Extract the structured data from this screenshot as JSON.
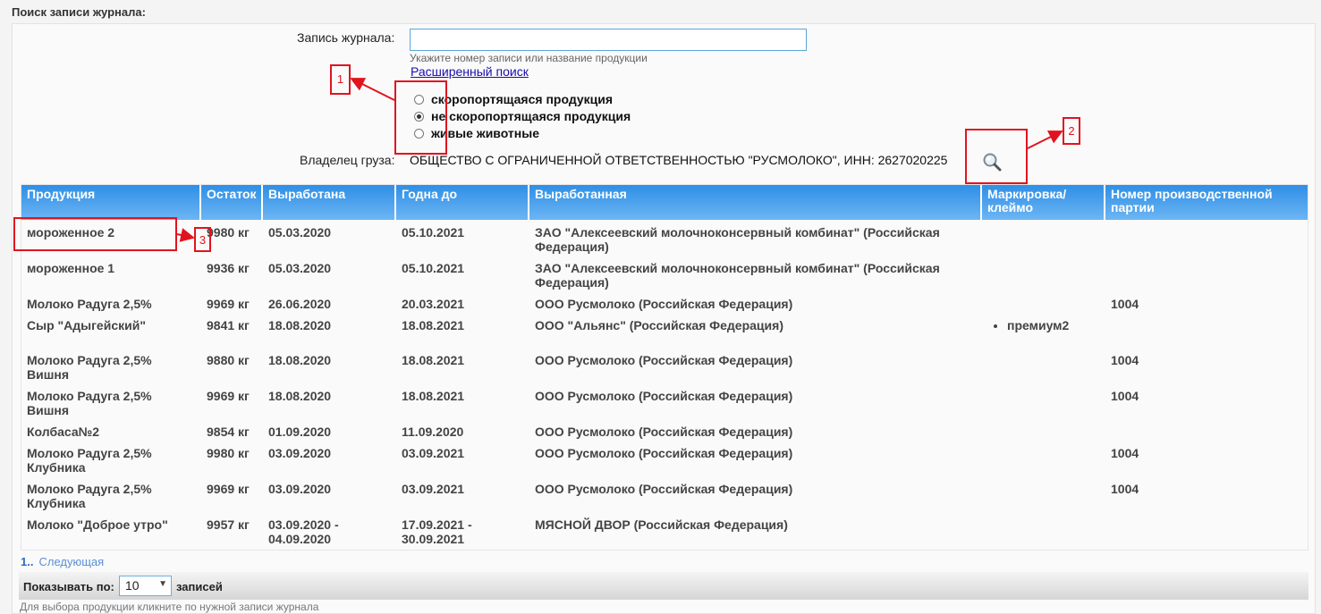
{
  "section_title": "Поиск записи журнала:",
  "search": {
    "label": "Запись журнала:",
    "value": "",
    "hint": "Укажите номер записи или название продукции",
    "advanced_link": "Расширенный поиск"
  },
  "product_type": {
    "options": [
      {
        "label": "скоропортящаяся продукция",
        "checked": false
      },
      {
        "label": "не скоропортящаяся продукция",
        "checked": true
      },
      {
        "label": "живые животные",
        "checked": false
      }
    ]
  },
  "owner": {
    "label": "Владелец груза:",
    "value": "ОБЩЕСТВО С ОГРАНИЧЕННОЙ ОТВЕТСТВЕННОСТЬЮ \"РУСМОЛОКО\", ИНН: 2627020225",
    "search_icon": "magnifier-icon"
  },
  "table": {
    "columns": [
      "Продукция",
      "Остаток",
      "Выработана",
      "Годна до",
      "Выработанная",
      "Маркировка/ клеймо",
      "Номер производственной партии"
    ],
    "rows": [
      {
        "product": "мороженное 2",
        "remain": "9980 кг",
        "produced": "05.03.2020",
        "valid": "05.10.2021",
        "producer": "ЗАО \"Алексеевский молочноконсервный комбинат\" (Российская Федерация)",
        "mark": "",
        "batch": ""
      },
      {
        "product": "мороженное 1",
        "remain": "9936 кг",
        "produced": "05.03.2020",
        "valid": "05.10.2021",
        "producer": "ЗАО \"Алексеевский молочноконсервный комбинат\" (Российская Федерация)",
        "mark": "",
        "batch": ""
      },
      {
        "product": "Молоко Радуга 2,5%",
        "remain": "9969 кг",
        "produced": "26.06.2020",
        "valid": "20.03.2021",
        "producer": "ООО Русмолоко (Российская Федерация)",
        "mark": "",
        "batch": "1004"
      },
      {
        "product": "Сыр \"Адыгейский\"",
        "remain": "9841 кг",
        "produced": "18.08.2020",
        "valid": "18.08.2021",
        "producer": "ООО \"Альянс\" (Российская Федерация)",
        "mark": "премиум2",
        "batch": ""
      },
      {
        "product": "Молоко Радуга 2,5% Вишня",
        "remain": "9880 кг",
        "produced": "18.08.2020",
        "valid": "18.08.2021",
        "producer": "ООО Русмолоко (Российская Федерация)",
        "mark": "",
        "batch": "1004"
      },
      {
        "product": "Молоко Радуга 2,5% Вишня",
        "remain": "9969 кг",
        "produced": "18.08.2020",
        "valid": "18.08.2021",
        "producer": "ООО Русмолоко (Российская Федерация)",
        "mark": "",
        "batch": "1004"
      },
      {
        "product": "Колбаса№2",
        "remain": "9854 кг",
        "produced": "01.09.2020",
        "valid": "11.09.2020",
        "producer": "ООО Русмолоко (Российская Федерация)",
        "mark": "",
        "batch": ""
      },
      {
        "product": "Молоко Радуга 2,5% Клубника",
        "remain": "9980 кг",
        "produced": "03.09.2020",
        "valid": "03.09.2021",
        "producer": "ООО Русмолоко (Российская Федерация)",
        "mark": "",
        "batch": "1004"
      },
      {
        "product": "Молоко Радуга 2,5% Клубника",
        "remain": "9969 кг",
        "produced": "03.09.2020",
        "valid": "03.09.2021",
        "producer": "ООО Русмолоко (Российская Федерация)",
        "mark": "",
        "batch": "1004"
      },
      {
        "product": "Молоко \"Доброе утро\"",
        "remain": "9957 кг",
        "produced": "03.09.2020 - 04.09.2020",
        "valid": "17.09.2021 - 30.09.2021",
        "producer": "МЯСНОЙ ДВОР (Российская Федерация)",
        "mark": "",
        "batch": ""
      }
    ]
  },
  "pager": {
    "current": "1..",
    "next": "Следующая"
  },
  "footer": {
    "show_label": "Показывать по:",
    "page_size": "10",
    "records_label": "записей",
    "hint": "Для выбора продукции кликните по нужной записи журнала"
  },
  "annotations": [
    "1",
    "2",
    "3"
  ],
  "colors": {
    "header_top": "#2f8fe6",
    "header_bottom": "#6cb5f3",
    "callout": "#e0141e",
    "link": "#1a0dab"
  }
}
